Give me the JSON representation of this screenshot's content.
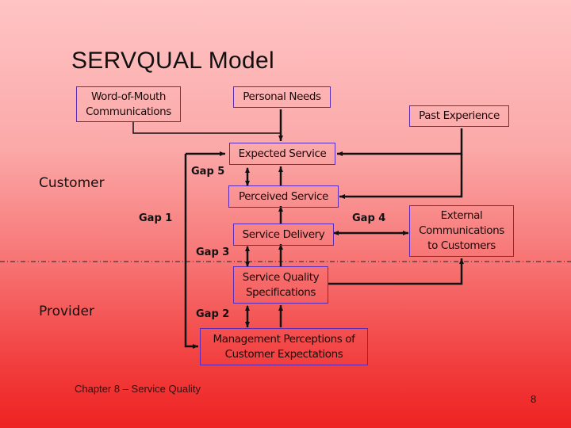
{
  "slide": {
    "title": "SERVQUAL Model",
    "footer_text": "Chapter 8 – Service Quality",
    "page_number": "8"
  },
  "regions": {
    "customer": "Customer",
    "provider": "Provider"
  },
  "boxes": {
    "word_of_mouth": [
      "Word-of-Mouth",
      "Communications"
    ],
    "personal_needs": "Personal Needs",
    "past_experience": "Past Experience",
    "expected_service": "Expected Service",
    "perceived_service": "Perceived Service",
    "service_delivery": "Service Delivery",
    "external_comms": [
      "External",
      "Communications",
      "to Customers"
    ],
    "service_quality_specs": [
      "Service Quality",
      "Specifications"
    ],
    "management_perceptions": [
      "Management Perceptions of",
      "Customer Expectations"
    ]
  },
  "gaps": {
    "gap1": "Gap 1",
    "gap2": "Gap 2",
    "gap3": "Gap 3",
    "gap4": "Gap 4",
    "gap5": "Gap 5"
  },
  "colors": {
    "box_border": "#5a2ab8",
    "line": "#111111"
  }
}
